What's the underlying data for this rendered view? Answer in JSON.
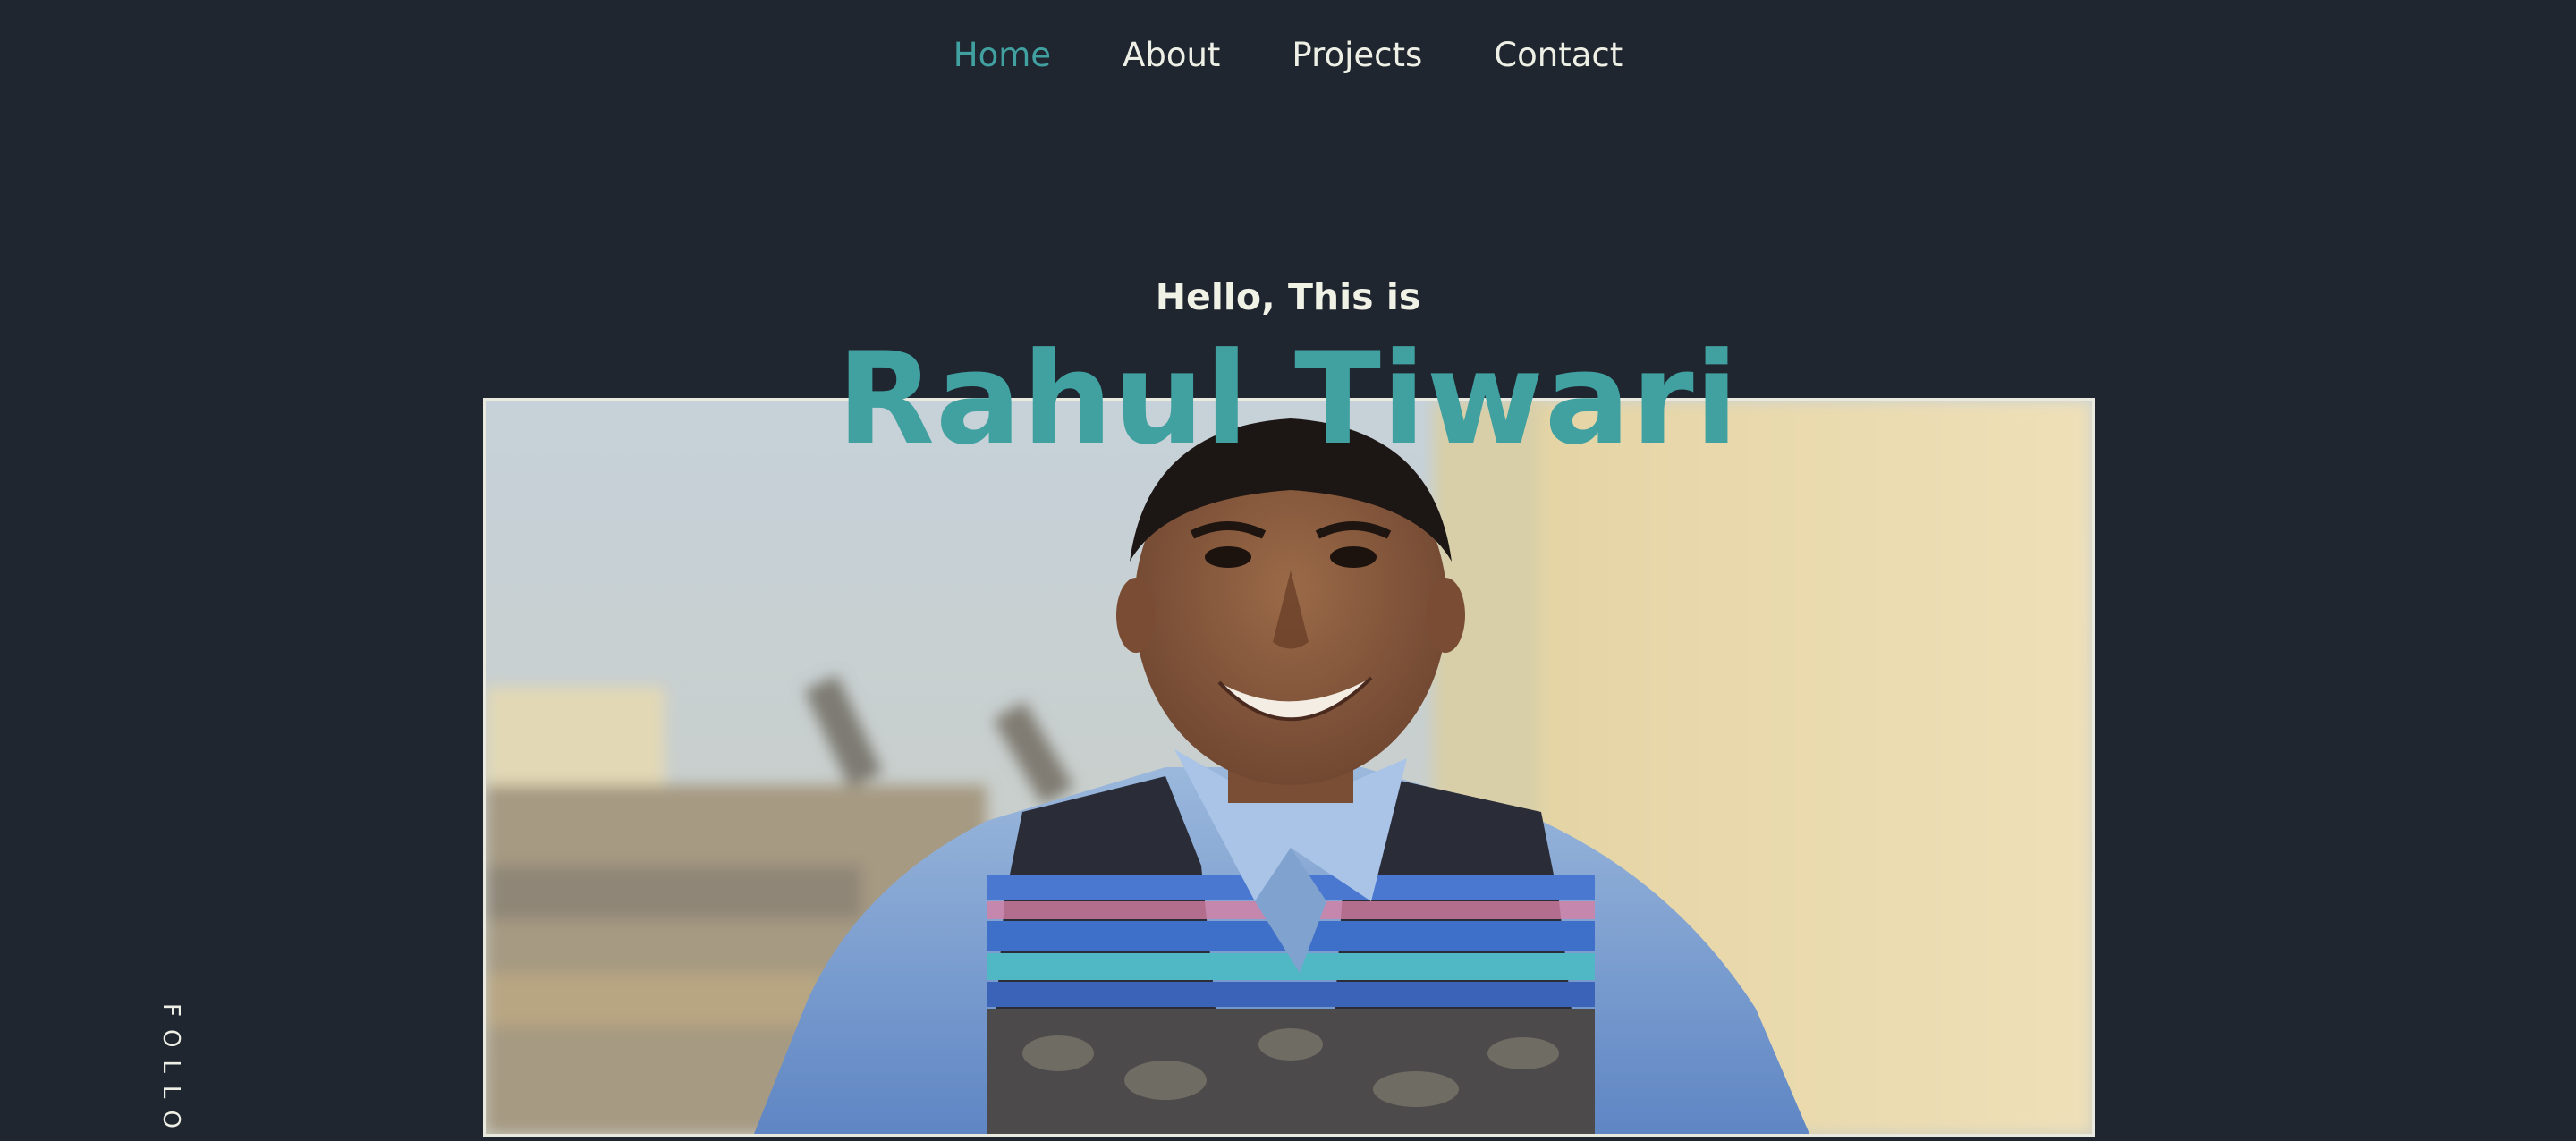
{
  "nav": {
    "items": [
      {
        "label": "Home",
        "active": true
      },
      {
        "label": "About",
        "active": false
      },
      {
        "label": "Projects",
        "active": false
      },
      {
        "label": "Contact",
        "active": false
      }
    ]
  },
  "hero": {
    "greeting": "Hello, This is",
    "name": "Rahul Tiwari"
  },
  "social": {
    "follow_label": "FOLLO"
  },
  "colors": {
    "background": "#1f2630",
    "accent": "#41a0a0",
    "text": "#eef0e6"
  }
}
